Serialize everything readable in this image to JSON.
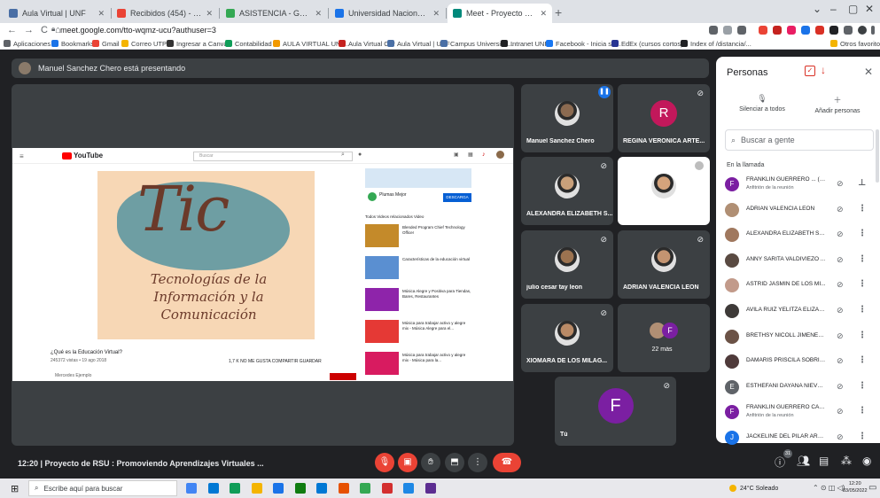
{
  "browser": {
    "tabs": [
      {
        "label": "Aula Virtual | UNF",
        "color": "#4a6fa5"
      },
      {
        "label": "Recibidos (454) - fguerrero@unf",
        "color": "#ea4335"
      },
      {
        "label": "ASISTENCIA - Google Drive",
        "color": "#34a853"
      },
      {
        "label": "Universidad Nacional de Fronter",
        "color": "#1a73e8"
      },
      {
        "label": "Meet - Proyecto de RSU - P",
        "color": "#00897b"
      }
    ],
    "new_tab": "+",
    "url": "meet.google.com/tto-wqmz-ucu?authuser=3",
    "bookmarks": [
      {
        "label": "Aplicaciones",
        "color": "#5f6368"
      },
      {
        "label": "Bookmarks",
        "color": "#1a73e8"
      },
      {
        "label": "Gmail",
        "color": "#ea4335"
      },
      {
        "label": "Correo UTP",
        "color": "#f4b400"
      },
      {
        "label": "Ingresar a Canvas",
        "color": "#333333"
      },
      {
        "label": "Contabilidad",
        "color": "#0f9d58"
      },
      {
        "label": "AULA VIRTUAL UNI...",
        "color": "#f29900"
      },
      {
        "label": "Aula Virtual CIP",
        "color": "#c5221f"
      },
      {
        "label": "Aula Virtual | UNF",
        "color": "#4a6fa5"
      },
      {
        "label": "Campus Universida...",
        "color": "#4a6fa5"
      },
      {
        "label": "Intranet UNF",
        "color": "#202124"
      },
      {
        "label": "Facebook - Inicia se...",
        "color": "#1877f2"
      },
      {
        "label": "EdEx (cursos cortos)",
        "color": "#283593"
      },
      {
        "label": "Index of /distancia/...",
        "color": "#202124"
      },
      {
        "label": "Otros favoritos",
        "color": "#f4b400"
      }
    ]
  },
  "meet": {
    "presenting_text": "Manuel Sanchez Chero está presentando",
    "screen_share": {
      "yt_logo": "YouTube",
      "yt_search_placeholder": "Buscar",
      "poster_title": "Tic",
      "poster_subtitle": "Tecnologías de la Información y la Comunicación",
      "video_title": "¿Qué es la Educación Virtual?",
      "video_meta": "245372 vistas • 19 ago 2018",
      "video_actions": "1,7 K   NO ME GUSTA   COMPARTIR   GUARDAR",
      "channel": "Mercedes Ejemplo",
      "ad_channel": "Plumas Mejor",
      "ad_button": "DESCARGA",
      "chips": "Todos   Videos relacionados   Video",
      "side_videos": [
        {
          "title": "Blended Program Chief Technology Officer",
          "color": "#c48a2a"
        },
        {
          "title": "Características de la educación virtual",
          "color": "#5a8fd1"
        },
        {
          "title": "Música Alegre y Positiva para Tiendas, Bares, Restaurantes",
          "color": "#8e24aa"
        },
        {
          "title": "Música para trabajar activo y alegre mix - Música Alegre para el...",
          "color": "#e53935"
        },
        {
          "title": "Música para trabajar activo y alegre mix - Música para la...",
          "color": "#d81b60"
        }
      ]
    },
    "participants": [
      {
        "name": "Manuel Sanchez Chero",
        "type": "photo",
        "skin": "#8b6a50",
        "bg": "#3c4043",
        "speaking": true
      },
      {
        "name": "REGINA VERONICA ARTE...",
        "type": "letter",
        "letter": "R",
        "avatar_color": "#c2185b",
        "muted": true
      },
      {
        "name": "ALEXANDRA ELIZABETH S...",
        "type": "photo",
        "skin": "#c9a07a",
        "muted": true
      },
      {
        "name": "",
        "type": "photo",
        "skin": "#d4a37c",
        "bg": "#ffffff",
        "badge": "grey"
      },
      {
        "name": "julio cesar tay leon",
        "type": "photo",
        "skin": "#9c7350",
        "muted": true
      },
      {
        "name": "ADRIAN VALENCIA LEON",
        "type": "photo",
        "skin": "#c49471",
        "muted": true
      },
      {
        "name": "XIOMARA DE LOS MILAG...",
        "type": "photo",
        "skin": "#b98a66",
        "muted": true
      },
      {
        "name": "22 más",
        "type": "group",
        "letter": "F",
        "avatar_color": "#7b1fa2"
      },
      {
        "name": "Tú",
        "type": "letter",
        "letter": "F",
        "avatar_color": "#7b1fa2",
        "muted": true
      }
    ],
    "meeting_info": "12:20  |  Proyecto de RSU : Promoviendo Aprendizajes Virtuales ...",
    "controls": {
      "mic_icon": "mic-off-icon",
      "cam_icon": "camera-off-icon",
      "raise_hand_icon": "hand-icon",
      "present_icon": "present-icon",
      "more_icon": "more-icon",
      "end_icon": "end-call-icon",
      "people_count": "31"
    }
  },
  "people_panel": {
    "title": "Personas",
    "mute_all": "Silenciar a todos",
    "add_people": "Añadir personas",
    "search_placeholder": "Buscar a gente",
    "in_call_label": "En la llamada",
    "people": [
      {
        "name": "FRANKLIN GUERRERO ... (Tú)",
        "role": "Anfitrión de la reunión",
        "letter": "F",
        "color": "#7b1fa2",
        "host": true
      },
      {
        "name": "ADRIAN VALENCIA LEON",
        "role": "",
        "letter": "",
        "color": "#b08f74"
      },
      {
        "name": "ALEXANDRA ELIZABETH SO...",
        "role": "",
        "letter": "",
        "color": "#a0785e"
      },
      {
        "name": "ANNY SARITA VALDIVIEZO ...",
        "role": "",
        "letter": "",
        "color": "#5a4a42"
      },
      {
        "name": "ASTRID JASMIN DE LOS MI...",
        "role": "",
        "letter": "",
        "color": "#c29a8a"
      },
      {
        "name": "AVILA RUIZ YELITZA ELIZAB...",
        "role": "",
        "letter": "",
        "color": "#3e3a38"
      },
      {
        "name": "BRETHSY NICOLL JIMENEZ ...",
        "role": "",
        "letter": "",
        "color": "#6b5246"
      },
      {
        "name": "DAMARIS PRISCILA SOBRIN...",
        "role": "",
        "letter": "",
        "color": "#4f3a3a"
      },
      {
        "name": "ESTHEFANI DAYANA NIEVE...",
        "role": "",
        "letter": "E",
        "color": "#5f6368"
      },
      {
        "name": "FRANKLIN GUERRERO CAM...",
        "role": "Anfitrión de la reunión",
        "letter": "F",
        "color": "#7b1fa2"
      },
      {
        "name": "JACKELINE DEL PILAR ARC...",
        "role": "",
        "letter": "J",
        "color": "#1a73e8"
      }
    ]
  },
  "taskbar": {
    "search_placeholder": "Escribe aquí para buscar",
    "weather": "24°C Soleado",
    "time": "12:20",
    "date": "03/05/2022",
    "apps": [
      "#4285f4",
      "#0078d4",
      "#0f9d58",
      "#f4b400",
      "#1a73e8",
      "#107c10",
      "#0078d4",
      "#e65100",
      "#34a853",
      "#d32f2f",
      "#1e88e5",
      "#5c2d91"
    ]
  }
}
